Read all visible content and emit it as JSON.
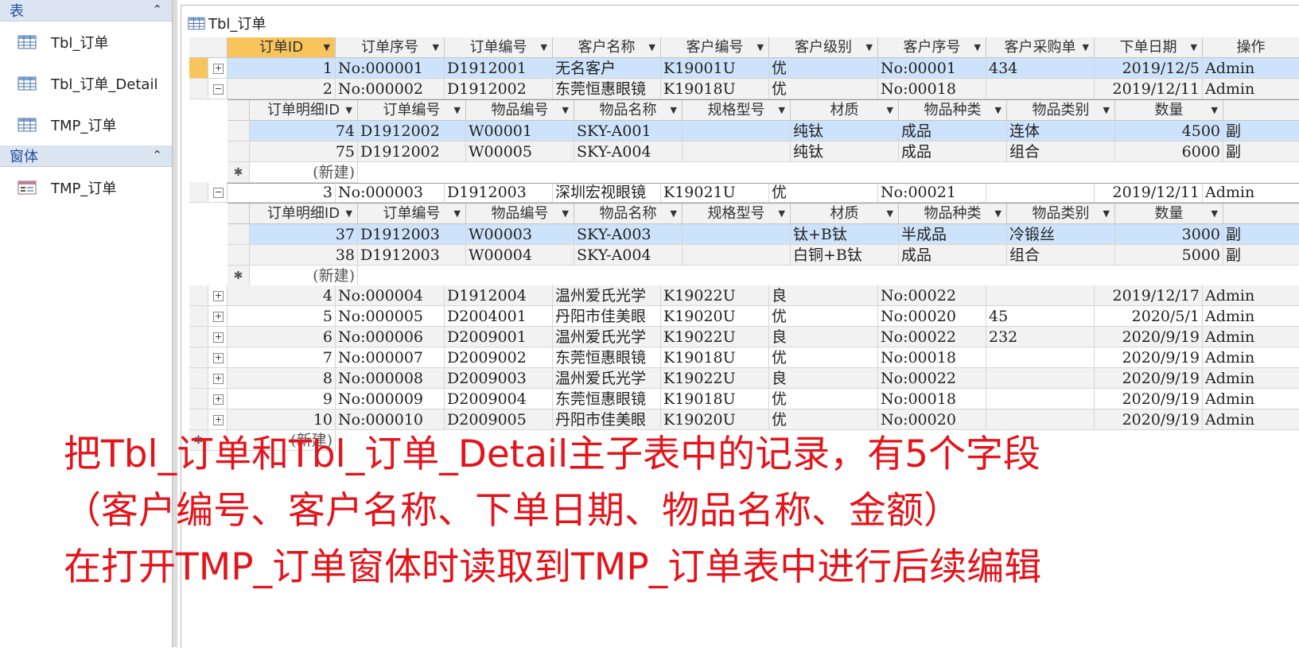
{
  "nav": {
    "sections": [
      {
        "title": "表",
        "items": [
          "Tbl_订单",
          "Tbl_订单_Detail",
          "TMP_订单"
        ]
      },
      {
        "title": "窗体",
        "items": [
          "TMP_订单"
        ]
      }
    ]
  },
  "doc": {
    "tab_title": "Tbl_订单"
  },
  "main_headers": [
    "订单ID",
    "订单序号",
    "订单编号",
    "客户名称",
    "客户编号",
    "客户级别",
    "客户序号",
    "客户采购单",
    "下单日期",
    "操作"
  ],
  "sub_headers": [
    "订单明细ID",
    "订单编号",
    "物品编号",
    "物品名称",
    "规格型号",
    "材质",
    "物品种类",
    "物品类别",
    "数量"
  ],
  "new_label": "(新建)",
  "orders": [
    {
      "id": "1",
      "seq": "No:000001",
      "code": "D1912001",
      "customer": "无名客户",
      "cust_code": "K19001U",
      "level": "优",
      "cust_seq": "No:00001",
      "po": "434",
      "date": "2019/12/5",
      "op": "Admin",
      "expanded": false
    },
    {
      "id": "2",
      "seq": "No:000002",
      "code": "D1912002",
      "customer": "东莞恒惠眼镜",
      "cust_code": "K19018U",
      "level": "优",
      "cust_seq": "No:00018",
      "po": "",
      "date": "2019/12/11",
      "op": "Admin",
      "expanded": true,
      "details": [
        {
          "id": "74",
          "code": "D1912002",
          "item_no": "W00001",
          "item_name": "SKY-A001",
          "spec": "",
          "material": "纯钛",
          "kind": "成品",
          "category": "连体",
          "qty": "4500",
          "extra": "副"
        },
        {
          "id": "75",
          "code": "D1912002",
          "item_no": "W00005",
          "item_name": "SKY-A004",
          "spec": "",
          "material": "纯钛",
          "kind": "成品",
          "category": "组合",
          "qty": "6000",
          "extra": "副"
        }
      ]
    },
    {
      "id": "3",
      "seq": "No:000003",
      "code": "D1912003",
      "customer": "深圳宏视眼镜",
      "cust_code": "K19021U",
      "level": "优",
      "cust_seq": "No:00021",
      "po": "",
      "date": "2019/12/11",
      "op": "Admin",
      "expanded": true,
      "details": [
        {
          "id": "37",
          "code": "D1912003",
          "item_no": "W00003",
          "item_name": "SKY-A003",
          "spec": "",
          "material": "钛+B钛",
          "kind": "半成品",
          "category": "冷锻丝",
          "qty": "3000",
          "extra": "副"
        },
        {
          "id": "38",
          "code": "D1912003",
          "item_no": "W00004",
          "item_name": "SKY-A004",
          "spec": "",
          "material": "白铜+B钛",
          "kind": "成品",
          "category": "组合",
          "qty": "5000",
          "extra": "副"
        }
      ]
    },
    {
      "id": "4",
      "seq": "No:000004",
      "code": "D1912004",
      "customer": "温州爱氏光学",
      "cust_code": "K19022U",
      "level": "良",
      "cust_seq": "No:00022",
      "po": "",
      "date": "2019/12/17",
      "op": "Admin",
      "expanded": false
    },
    {
      "id": "5",
      "seq": "No:000005",
      "code": "D2004001",
      "customer": "丹阳市佳美眼",
      "cust_code": "K19020U",
      "level": "优",
      "cust_seq": "No:00020",
      "po": "45",
      "date": "2020/5/1",
      "op": "Admin",
      "expanded": false
    },
    {
      "id": "6",
      "seq": "No:000006",
      "code": "D2009001",
      "customer": "温州爱氏光学",
      "cust_code": "K19022U",
      "level": "良",
      "cust_seq": "No:00022",
      "po": "232",
      "date": "2020/9/19",
      "op": "Admin",
      "expanded": false
    },
    {
      "id": "7",
      "seq": "No:000007",
      "code": "D2009002",
      "customer": "东莞恒惠眼镜",
      "cust_code": "K19018U",
      "level": "优",
      "cust_seq": "No:00018",
      "po": "",
      "date": "2020/9/19",
      "op": "Admin",
      "expanded": false
    },
    {
      "id": "8",
      "seq": "No:000008",
      "code": "D2009003",
      "customer": "温州爱氏光学",
      "cust_code": "K19022U",
      "level": "良",
      "cust_seq": "No:00022",
      "po": "",
      "date": "2020/9/19",
      "op": "Admin",
      "expanded": false
    },
    {
      "id": "9",
      "seq": "No:000009",
      "code": "D2009004",
      "customer": "东莞恒惠眼镜",
      "cust_code": "K19018U",
      "level": "优",
      "cust_seq": "No:00018",
      "po": "",
      "date": "2020/9/19",
      "op": "Admin",
      "expanded": false
    },
    {
      "id": "10",
      "seq": "No:000010",
      "code": "D2009005",
      "customer": "丹阳市佳美眼",
      "cust_code": "K19020U",
      "level": "优",
      "cust_seq": "No:00020",
      "po": "",
      "date": "2020/9/19",
      "op": "Admin",
      "expanded": false
    }
  ],
  "caption": {
    "line1": "把Tbl_订单和Tbl_订单_Detail主子表中的记录，有5个字段",
    "line2": "（客户编号、客户名称、下单日期、物品名称、金额）",
    "line3": "在打开TMP_订单窗体时读取到TMP_订单表中进行后续编辑"
  },
  "colors": {
    "caption": "#e4141b",
    "selected_header": "#f8c55c",
    "selected_row": "#cde2fb",
    "nav_header": "#dbe4f1"
  }
}
